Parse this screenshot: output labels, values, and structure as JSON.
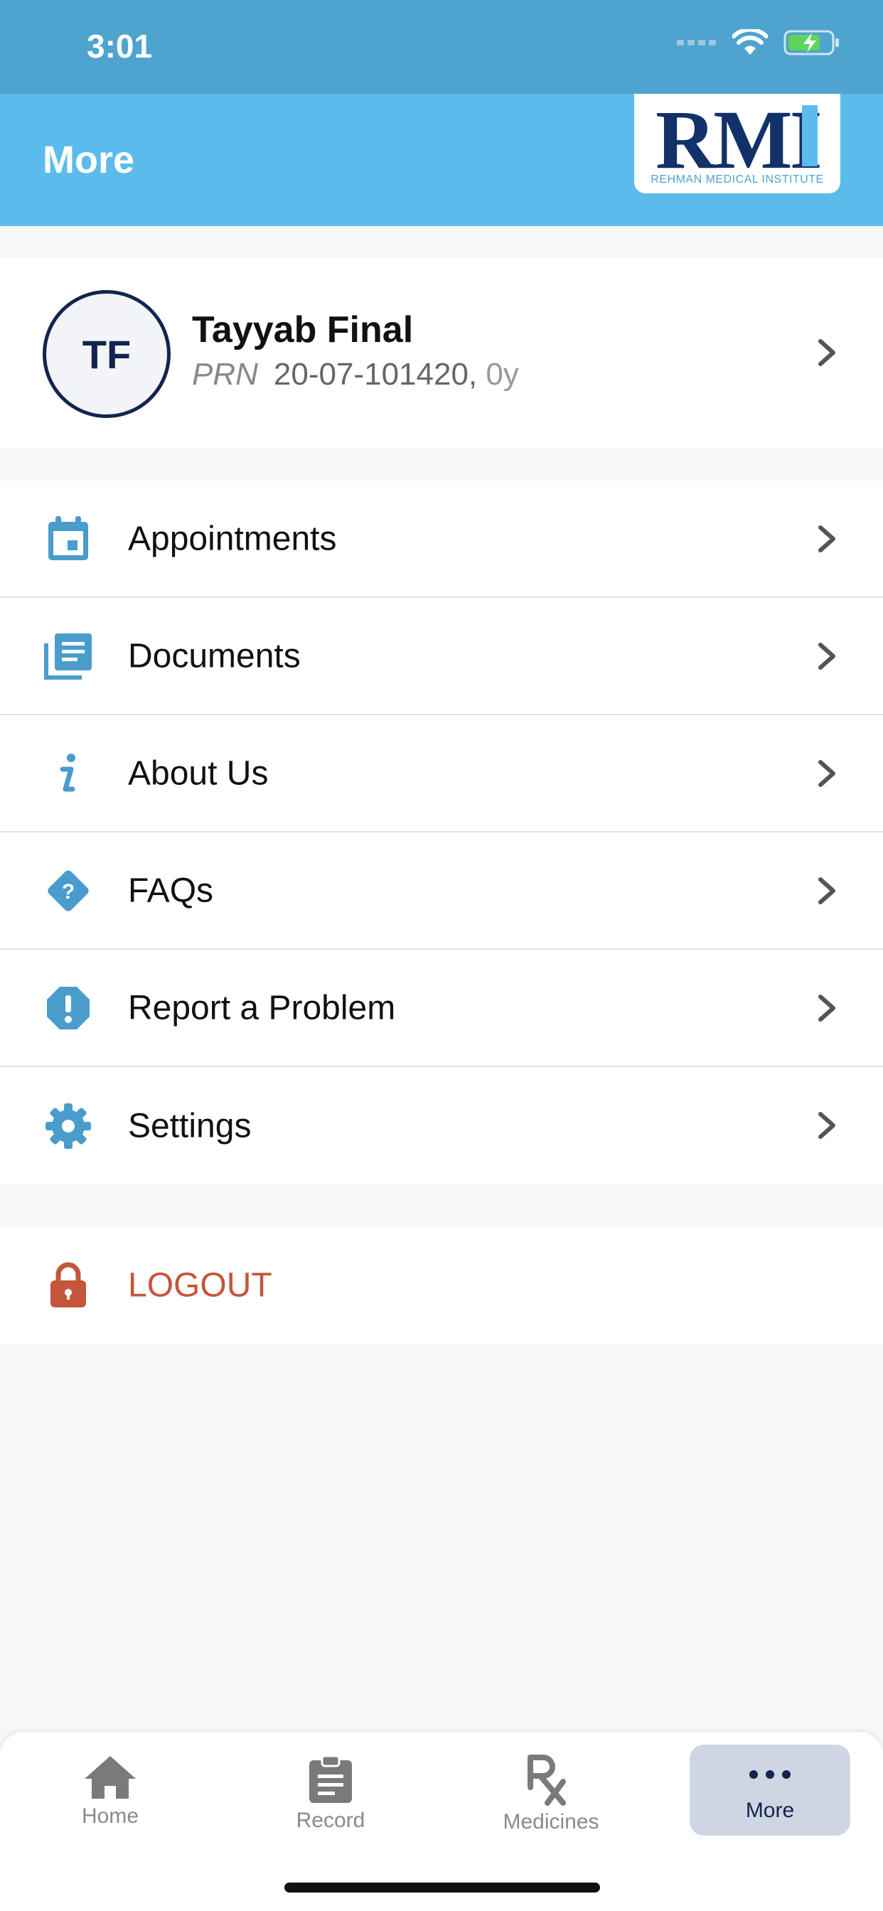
{
  "status_bar": {
    "time": "3:01"
  },
  "header": {
    "title": "More"
  },
  "logo": {
    "mark": "RMI",
    "subtitle": "REHMAN MEDICAL INSTITUTE"
  },
  "profile": {
    "initials": "TF",
    "name": "Tayyab Final",
    "prn_label": "PRN",
    "prn_value": "20-07-101420,",
    "age": "0y"
  },
  "menu": {
    "items": [
      {
        "label": "Appointments",
        "icon": "calendar-icon"
      },
      {
        "label": "Documents",
        "icon": "documents-icon"
      },
      {
        "label": "About Us",
        "icon": "info-icon"
      },
      {
        "label": "FAQs",
        "icon": "question-icon"
      },
      {
        "label": "Report a Problem",
        "icon": "alert-icon"
      },
      {
        "label": "Settings",
        "icon": "gear-icon"
      }
    ]
  },
  "logout": {
    "label": "LOGOUT",
    "icon": "lock-icon"
  },
  "tabbar": {
    "tabs": [
      {
        "label": "Home",
        "icon": "home-icon"
      },
      {
        "label": "Record",
        "icon": "clipboard-icon"
      },
      {
        "label": "Medicines",
        "icon": "rx-icon"
      },
      {
        "label": "More",
        "icon": "more-dots-icon",
        "active": true
      }
    ]
  },
  "colors": {
    "status_bar": "#4fa3cf",
    "header": "#5bbcec",
    "icon_blue": "#4a9ccc",
    "logout": "#c4563a",
    "navy": "#12244f"
  }
}
